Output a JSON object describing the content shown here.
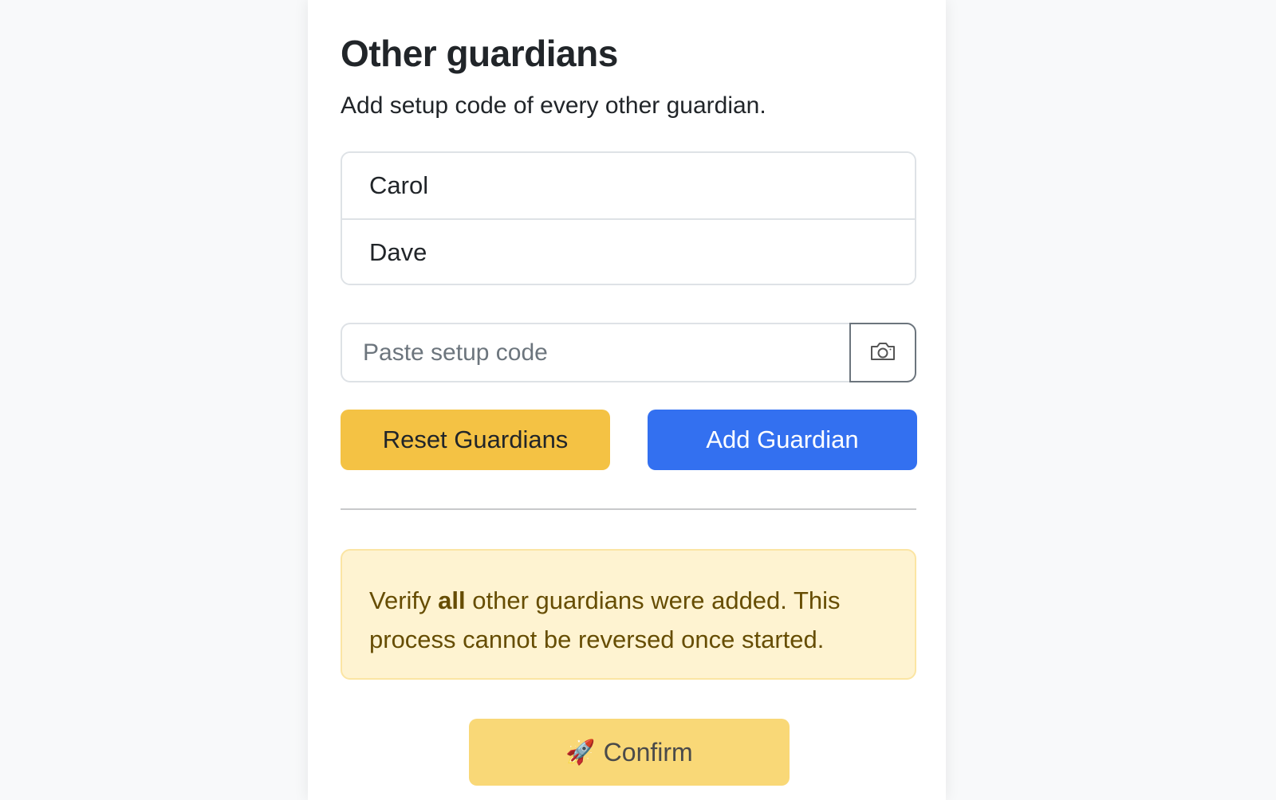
{
  "page": {
    "title": "Other guardians",
    "subtitle": "Add setup code of every other guardian."
  },
  "guardians": [
    {
      "name": "Carol"
    },
    {
      "name": "Dave"
    }
  ],
  "setup_code": {
    "value": "",
    "placeholder": "Paste setup code",
    "camera_icon": "camera-icon"
  },
  "actions": {
    "reset_label": "Reset Guardians",
    "add_label": "Add Guardian",
    "confirm_icon": "rocket-icon",
    "confirm_emoji": "🚀",
    "confirm_label": "Confirm"
  },
  "alert": {
    "prefix": "Verify ",
    "emphasis": "all",
    "suffix": " other guardians were added. This process cannot be reversed once started."
  },
  "colors": {
    "reset_button": "#f4c244",
    "add_button": "#3370f0",
    "confirm_button": "#f9d877",
    "alert_background": "#fef3d1",
    "alert_text": "#664d03"
  }
}
